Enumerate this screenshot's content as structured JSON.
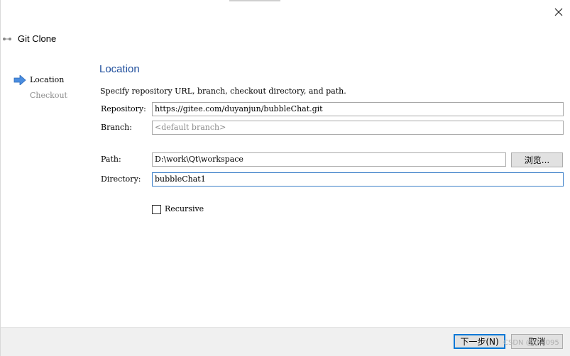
{
  "window": {
    "title": "Git Clone",
    "colors": {
      "accent": "#1f4e9c",
      "focus": "#3c7fc8",
      "step_arrow": "#4a8de0"
    }
  },
  "steps": {
    "items": [
      {
        "label": "Location",
        "active": true
      },
      {
        "label": "Checkout",
        "active": false
      }
    ]
  },
  "page": {
    "title": "Location",
    "description": "Specify repository URL, branch, checkout directory, and path."
  },
  "form": {
    "repository": {
      "label": "Repository:",
      "value": "https://gitee.com/duyanjun/bubbleChat.git"
    },
    "branch": {
      "label": "Branch:",
      "placeholder": "<default branch>"
    },
    "path": {
      "label": "Path:",
      "value": "D:\\work\\Qt\\workspace",
      "browse_label": "浏览..."
    },
    "directory": {
      "label": "Directory:",
      "value": "bubbleChat1"
    },
    "recursive": {
      "label": "Recursive",
      "checked": false
    }
  },
  "footer": {
    "next_label": "下一步(N)",
    "cancel_label": "取消",
    "watermark": "CSDN @zhd095"
  }
}
